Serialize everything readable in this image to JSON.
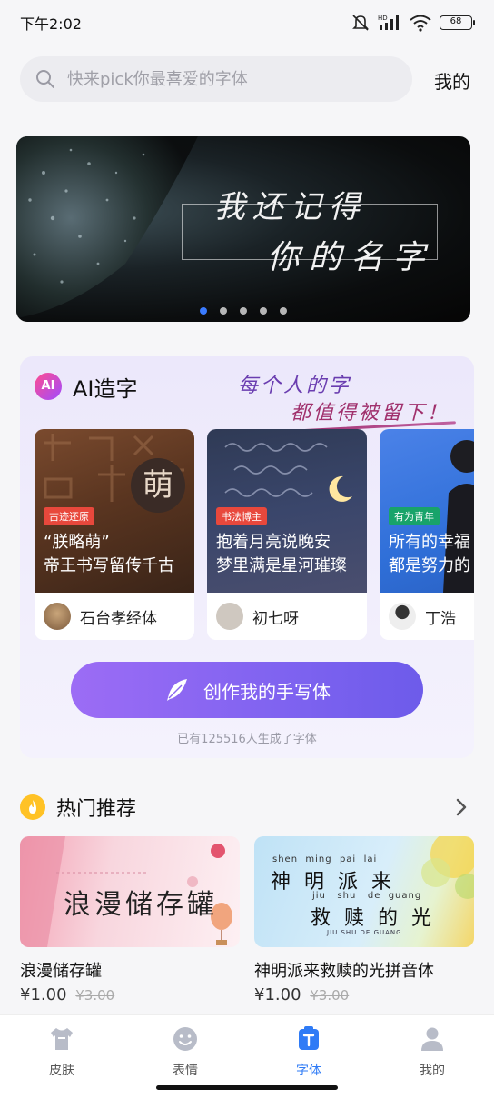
{
  "status": {
    "time": "下午2:02",
    "battery": "68",
    "icons": [
      "mute-icon",
      "hd-signal-icon",
      "wifi-icon",
      "battery-icon"
    ]
  },
  "search": {
    "placeholder": "快来pick你最喜爱的字体",
    "mine": "我的"
  },
  "banner": {
    "line1": "我还记得",
    "line2": "你的名字",
    "dot_count": 5,
    "active_dot": 1
  },
  "ai": {
    "logo": "AI",
    "title": "AI造字",
    "slogan_line1": "每个人的字",
    "slogan_line2": "都值得被留下！",
    "cards": [
      {
        "tag": "古迹还原",
        "line1": "“朕略萌”",
        "line2": "帝王书写留传千古",
        "author": "石台孝经体",
        "big_char": "萌",
        "tag_color": "#e8483c"
      },
      {
        "tag": "书法博主",
        "line1": "抱着月亮说晚安",
        "line2": "梦里满是星河璀璨",
        "author": "初七呀",
        "tag_color": "#e8483c"
      },
      {
        "tag": "有为青年",
        "line1": "所有的幸福",
        "line2": "都是努力的",
        "author": "丁浩",
        "tag_color": "#18a36a"
      }
    ],
    "create_button": "创作我的手写体",
    "count_text": "已有125516人生成了字体"
  },
  "hot": {
    "title": "热门推荐",
    "products": [
      {
        "name": "浪漫储存罐",
        "price": "¥1.00",
        "original_price": "¥3.00",
        "cover_text": "浪漫储存罐"
      },
      {
        "name": "神明派来救赎的光拼音体",
        "price": "¥1.00",
        "original_price": "¥3.00",
        "cover_pinyin_1": "shen  ming  pai  lai",
        "cover_chars_1": "神 明 派 来",
        "cover_pinyin_2": "jiu   shu   de  guang",
        "cover_chars_2": "救 赎 的 光",
        "cover_caption": "JIU SHU DE GUANG"
      }
    ]
  },
  "nav": {
    "items": [
      {
        "label": "皮肤",
        "icon": "shirt-icon",
        "active": false
      },
      {
        "label": "表情",
        "icon": "emoji-icon",
        "active": false
      },
      {
        "label": "字体",
        "icon": "font-icon",
        "active": true
      },
      {
        "label": "我的",
        "icon": "profile-icon",
        "active": false
      }
    ],
    "active_color": "#2f7bf6"
  }
}
